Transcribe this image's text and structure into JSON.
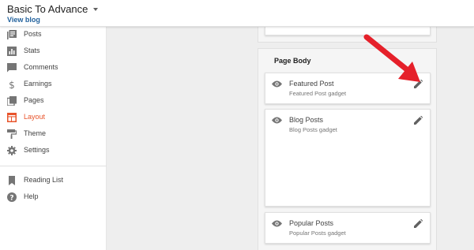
{
  "header": {
    "blog_title": "Basic To Advance",
    "view_blog": "View blog"
  },
  "sidebar": {
    "items": [
      {
        "label": "Posts",
        "icon": "posts-icon"
      },
      {
        "label": "Stats",
        "icon": "stats-icon"
      },
      {
        "label": "Comments",
        "icon": "comments-icon"
      },
      {
        "label": "Earnings",
        "icon": "dollar-icon"
      },
      {
        "label": "Pages",
        "icon": "pages-icon"
      },
      {
        "label": "Layout",
        "icon": "layout-icon",
        "active": true
      },
      {
        "label": "Theme",
        "icon": "paint-roller-icon"
      },
      {
        "label": "Settings",
        "icon": "gear-icon"
      }
    ],
    "secondary": [
      {
        "label": "Reading List",
        "icon": "bookmark-icon"
      },
      {
        "label": "Help",
        "icon": "help-icon"
      }
    ]
  },
  "layout": {
    "section_title": "Page Body",
    "gadgets": [
      {
        "name": "Featured Post",
        "subtitle": "Featured Post gadget"
      },
      {
        "name": "Blog Posts",
        "subtitle": "Blog Posts gadget"
      },
      {
        "name": "Popular Posts",
        "subtitle": "Popular Posts gadget"
      }
    ]
  },
  "colors": {
    "accent": "#e8542b",
    "link": "#23629d",
    "arrow": "#e5202a"
  }
}
